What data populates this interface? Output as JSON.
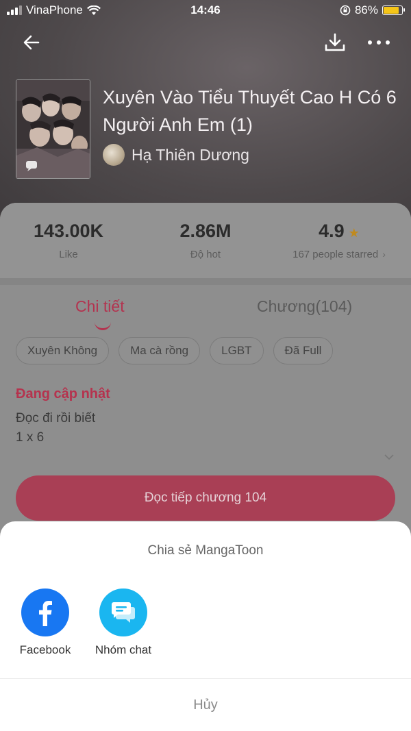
{
  "status_bar": {
    "carrier": "VinaPhone",
    "time": "14:46",
    "battery": "86%",
    "battery_level": 0.86
  },
  "nav": {
    "back_icon": "arrow-left-icon",
    "download_icon": "download-icon",
    "more_icon": "more-horizontal-icon"
  },
  "book": {
    "title": "Xuyên Vào Tiểu Thuyết Cao H Có 6 Người Anh Em (1)",
    "author": "Hạ Thiên Dương"
  },
  "stats": {
    "likes": "143.00K",
    "likes_label": "Like",
    "hot": "2.86M",
    "hot_label": "Độ hot",
    "rating": "4.9",
    "rating_label": "167 people starred"
  },
  "tabs": [
    {
      "label": "Chi tiết",
      "active": true
    },
    {
      "label": "Chương(104)",
      "active": false
    }
  ],
  "tags": [
    "Xuyên Không",
    "Ma cà rồng",
    "LGBT",
    "Đã Full"
  ],
  "status_title": "Đang cập nhật",
  "description": [
    "Đọc đi rồi biết",
    "1 x 6"
  ],
  "read_button": "Đọc tiếp chương 104",
  "share_sheet": {
    "title": "Chia sẻ MangaToon",
    "options": [
      {
        "label": "Facebook",
        "icon": "facebook-icon"
      },
      {
        "label": "Nhóm chat",
        "icon": "chat-bubbles-icon"
      }
    ],
    "cancel": "Hủy"
  },
  "colors": {
    "accent": "#e0475f",
    "facebook": "#1877f2",
    "chat": "#1ab6f0"
  }
}
